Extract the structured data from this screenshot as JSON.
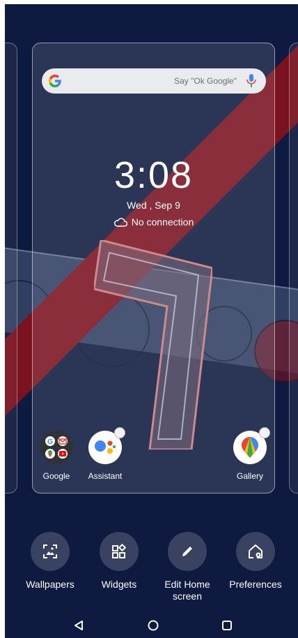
{
  "search": {
    "placeholder": "Say \"Ok Google\""
  },
  "clock": {
    "time": "3:08",
    "date": "Wed , Sep 9",
    "weather": "No connection"
  },
  "apps": [
    {
      "label": "Google",
      "icon": "google-folder-icon"
    },
    {
      "label": "Assistant",
      "icon": "assistant-icon"
    },
    {
      "label": "Gallery",
      "icon": "gallery-icon"
    }
  ],
  "actions": [
    {
      "label": "Wallpapers",
      "icon": "wallpaper-icon"
    },
    {
      "label": "Widgets",
      "icon": "widgets-icon"
    },
    {
      "label": "Edit Home screen",
      "icon": "pencil-icon"
    },
    {
      "label": "Preferences",
      "icon": "home-settings-icon"
    }
  ],
  "nav": {
    "back": "back-icon",
    "home": "home-icon",
    "recents": "recents-icon"
  },
  "colors": {
    "background": "#0e1a3f",
    "stripe": "#7a1220"
  }
}
